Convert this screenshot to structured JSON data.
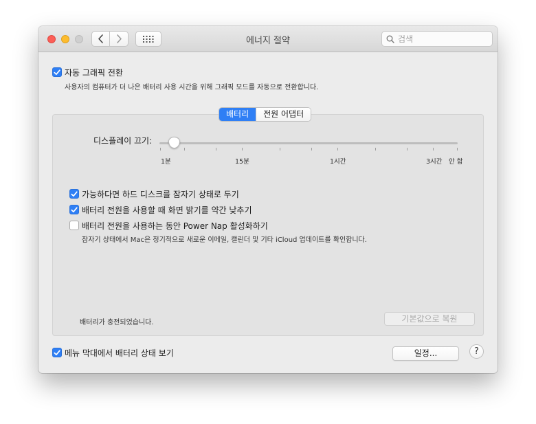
{
  "window": {
    "title": "에너지 절약",
    "search_placeholder": "검색"
  },
  "top": {
    "auto_graphics_label": "자동 그래픽 전환",
    "auto_graphics_checked": true,
    "auto_graphics_desc": "사용자의 컴퓨터가 더 나은 배터리 사용 시간을 위해 그래픽 모드를 자동으로 전환합니다."
  },
  "tabs": [
    {
      "label": "배터리",
      "active": true
    },
    {
      "label": "전원 어댑터",
      "active": false
    }
  ],
  "slider": {
    "label": "디스플레이 끄기:",
    "tick_labels": [
      "1분",
      "15분",
      "1시간",
      "3시간",
      "안 함"
    ],
    "value": "2분"
  },
  "options": [
    {
      "label": "가능하다면 하드 디스크를 잠자기 상태로 두기",
      "checked": true
    },
    {
      "label": "배터리 전원을 사용할 때 화면 밝기를 약간 낮추기",
      "checked": true
    },
    {
      "label": "배터리 전원을 사용하는 동안 Power Nap 활성화하기",
      "checked": false
    }
  ],
  "power_nap_desc": "잠자기 상태에서 Mac은 정기적으로 새로운 이메일, 캘린더 및 기타 iCloud 업데이트를 확인합니다.",
  "battery_status": "배터리가 충전되었습니다.",
  "restore_defaults_label": "기본값으로 복원",
  "bottom": {
    "menubar_label": "메뉴 막대에서 배터리 상태 보기",
    "menubar_checked": true,
    "schedule_label": "일정...",
    "help_label": "?"
  },
  "colors": {
    "accent": "#2f7ff5",
    "close": "#fc5e57",
    "minimize": "#fdbc2e",
    "zoom_disabled": "#cfcfcf"
  }
}
